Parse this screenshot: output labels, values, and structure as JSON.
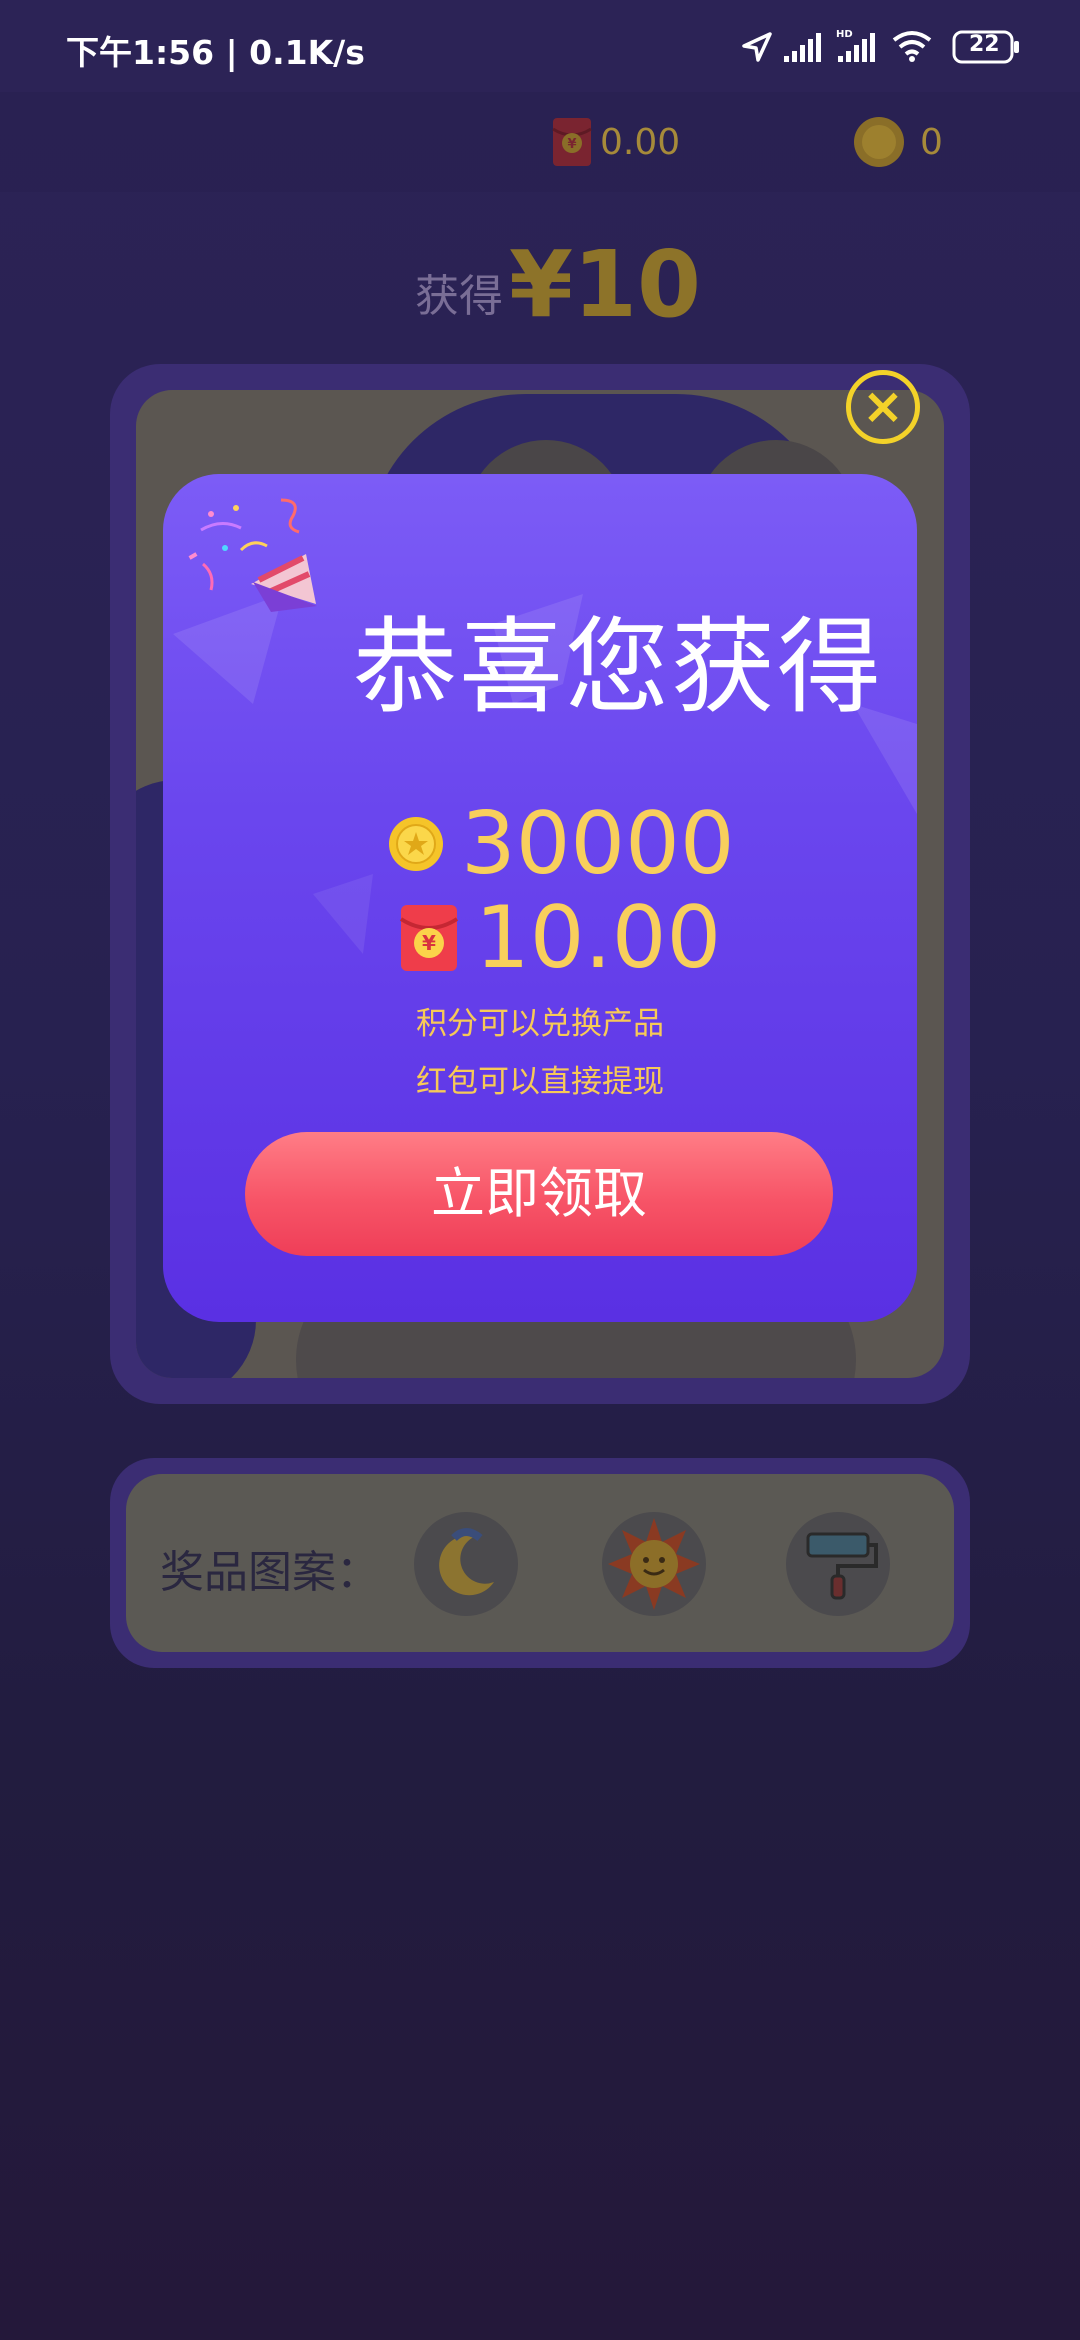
{
  "status_bar": {
    "time": "下午1:56 | 0.1K/s",
    "battery": "22"
  },
  "balance": {
    "red_packet": "0.00",
    "coins": "0"
  },
  "earn": {
    "label": "获得",
    "amount": "¥10"
  },
  "prize_row": {
    "label": "奖品图案：",
    "icons": [
      "moon-icon",
      "sun-icon",
      "paint-roller-icon"
    ]
  },
  "modal": {
    "title": "恭喜您获得",
    "coins_value": "30000",
    "red_packet_value": "10.00",
    "note_1": "积分可以兑换产品",
    "note_2": "红包可以直接提现",
    "claim_label": "立即领取"
  },
  "colors": {
    "modal_top": "#7c5cf6",
    "modal_bottom": "#5a30e3",
    "gold": "#f8cf5c",
    "button_red": "#f75467",
    "close_yellow": "#f3d229"
  }
}
